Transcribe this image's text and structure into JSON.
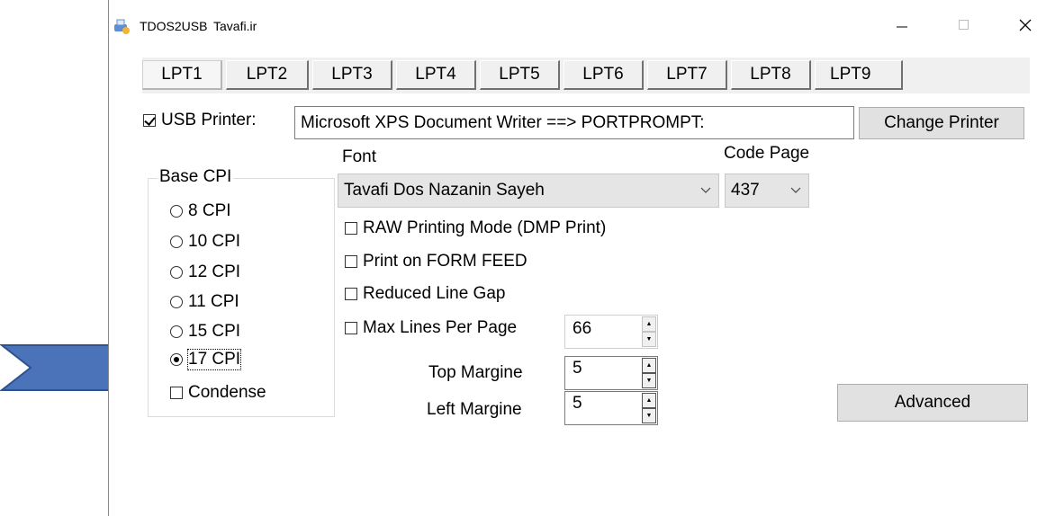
{
  "titlebar": {
    "app_name": "TDOS2USB",
    "subtitle": "Tavafi.ir",
    "minimize": "—",
    "maximize": "☐",
    "close": "✕"
  },
  "tabs": [
    {
      "label": "LPT1",
      "active": true
    },
    {
      "label": "LPT2"
    },
    {
      "label": "LPT3"
    },
    {
      "label": "LPT4"
    },
    {
      "label": "LPT5"
    },
    {
      "label": "LPT6"
    },
    {
      "label": "LPT7"
    },
    {
      "label": "LPT8"
    },
    {
      "label": "LPT9"
    }
  ],
  "usb": {
    "label": "USB Printer:",
    "checked": true,
    "printer_value": "Microsoft XPS Document Writer ==> PORTPROMPT:",
    "change_button": "Change Printer"
  },
  "base_cpi": {
    "title": "Base CPI",
    "options": [
      "8 CPI",
      "10 CPI",
      "12 CPI",
      "11 CPI",
      "15 CPI",
      "17 CPI"
    ],
    "selected": "17 CPI",
    "condense_label": "Condense"
  },
  "font": {
    "label": "Font",
    "value": "Tavafi Dos Nazanin Sayeh"
  },
  "code_page": {
    "label": "Code Page",
    "value": "437"
  },
  "options": {
    "raw_printing": "RAW Printing Mode (DMP Print)",
    "form_feed": "Print on FORM FEED",
    "reduced_gap": "Reduced Line Gap",
    "max_lines": "Max Lines Per Page"
  },
  "values": {
    "max_lines": "66",
    "top_margin_label": "Top Margine",
    "top_margin": "5",
    "left_margin_label": "Left Margine",
    "left_margin": "5"
  },
  "advanced_button": "Advanced",
  "colors": {
    "arrow_fill": "#4a73ba",
    "arrow_stroke": "#2f528f"
  }
}
